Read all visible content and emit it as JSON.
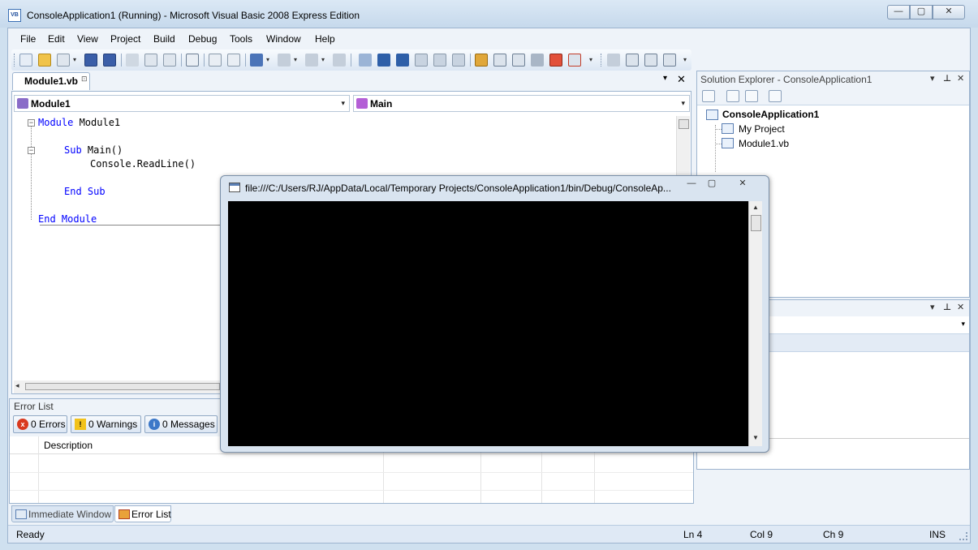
{
  "window": {
    "title": "ConsoleApplication1 (Running) - Microsoft Visual Basic 2008 Express Edition",
    "icon_label": "VB",
    "controls": {
      "minimize": "—",
      "maximize": "▢",
      "close": "✕"
    }
  },
  "menubar": {
    "items": [
      "File",
      "Edit",
      "View",
      "Project",
      "Build",
      "Debug",
      "Tools",
      "Window",
      "Help"
    ]
  },
  "document": {
    "tab_label": "Module1.vb",
    "tab_pin": "⊡",
    "dropdown_icon": "▾",
    "close_glyph": "✕"
  },
  "editor": {
    "left_combo": "Module1",
    "right_combo": "Main",
    "combo_arrow": "▾",
    "fold_open": "−",
    "code": {
      "line1_kw": "Module",
      "line1_name": " Module1",
      "line2_kw": "Sub",
      "line2_name": " Main()",
      "line3": "Console.ReadLine()",
      "line4_kw": "End Sub",
      "line5_kw": "End Module"
    },
    "hscroll_left": "◂"
  },
  "error_list": {
    "caption": "Error List",
    "errors_label": "0 Errors",
    "warnings_label": "0 Warnings",
    "messages_label": "0 Messages",
    "description_header": "Description",
    "errors_icon_glyph": "x",
    "warnings_icon_glyph": "!",
    "messages_icon_glyph": "i"
  },
  "bottom_tabs": {
    "immediate": "Immediate Window",
    "errorlist": "Error List"
  },
  "solution_explorer": {
    "title": "Solution Explorer - ConsoleApplication1",
    "pane_dropdown": "▾",
    "pane_pin": "⊥",
    "pane_close": "✕",
    "root": "ConsoleApplication1",
    "items": [
      "My Project",
      "Module1.vb"
    ]
  },
  "properties": {
    "pane_dropdown": "▾",
    "pane_pin": "⊥",
    "pane_close": "✕",
    "combo_arrow": "▾"
  },
  "statusbar": {
    "state": "Ready",
    "line": "Ln 4",
    "col": "Col 9",
    "ch": "Ch 9",
    "mode": "INS"
  },
  "console": {
    "title": "file:///C:/Users/RJ/AppData/Local/Temporary Projects/ConsoleApplication1/bin/Debug/ConsoleAp...",
    "minimize": "—",
    "maximize": "▢",
    "close": "✕",
    "scroll_up": "▲",
    "scroll_down": "▼"
  },
  "colors": {
    "accent": "#3a6fb5",
    "keyword": "#0000ff",
    "console_bg": "#000000",
    "error_red": "#d9391f",
    "warning_yellow": "#f2c21a",
    "info_blue": "#3c78c8"
  },
  "icons": {
    "toolbar": [
      "new-project-icon",
      "open-icon",
      "add-item-icon",
      "save-icon",
      "save-all-icon",
      "cut-icon",
      "copy-icon",
      "paste-icon",
      "find-icon",
      "comment-icon",
      "uncomment-icon",
      "undo-icon",
      "redo-icon",
      "navigate-back-icon",
      "navigate-forward-icon",
      "start-debug-icon",
      "break-all-icon",
      "stop-debug-icon",
      "step-into-icon",
      "step-over-icon",
      "step-out-icon",
      "solution-explorer-icon",
      "properties-icon",
      "object-browser-icon",
      "toolbox-icon",
      "error-list-icon",
      "command-icon"
    ]
  }
}
